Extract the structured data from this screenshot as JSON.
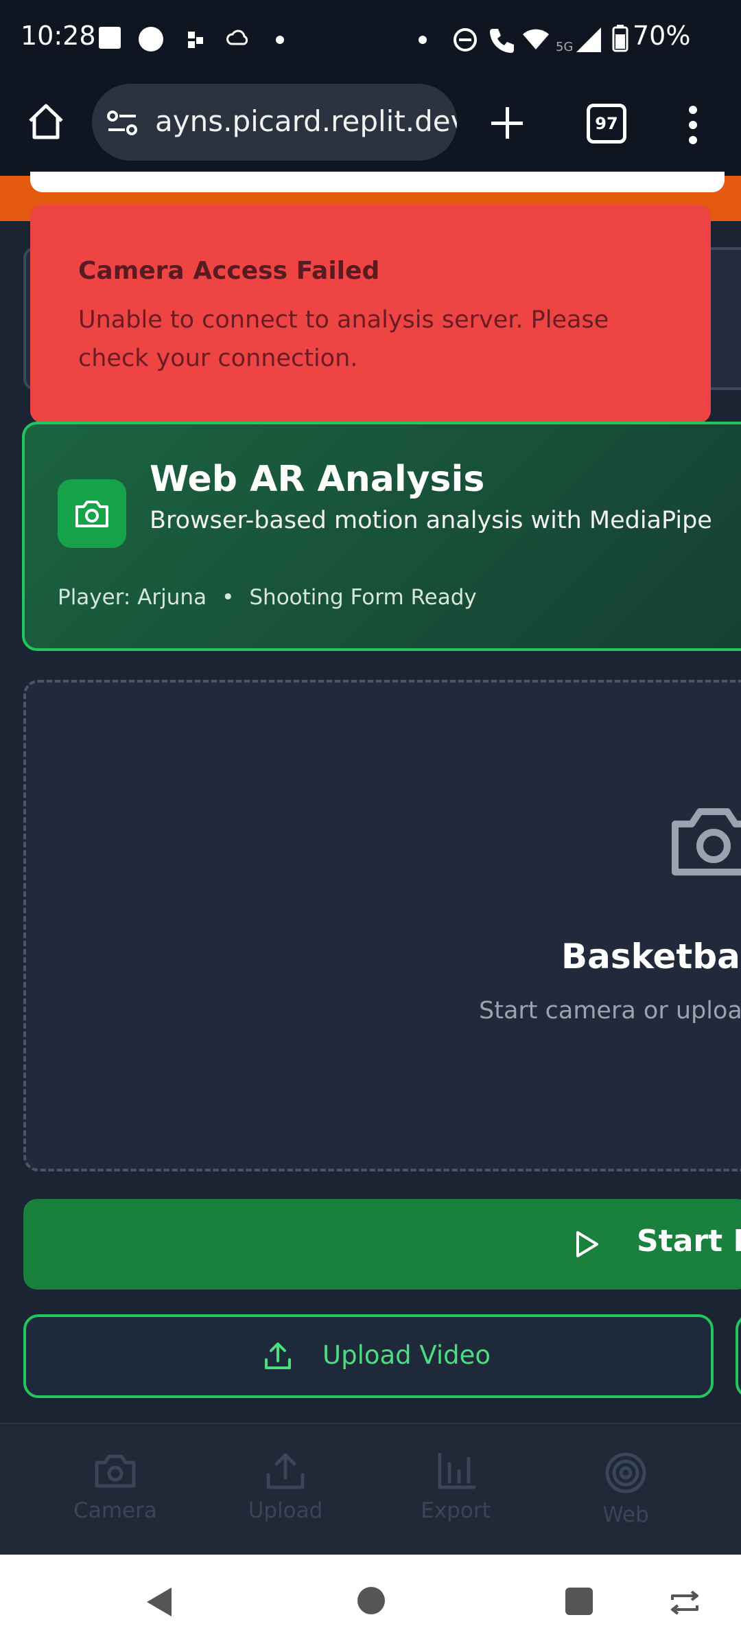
{
  "status_bar": {
    "time": "10:28",
    "network": "5G",
    "battery": "70%"
  },
  "browser": {
    "url": "ayns.picard.replit.dev",
    "tab_count": "97"
  },
  "toast": {
    "title": "Camera Access Failed",
    "message": "Unable to connect to analysis server. Please check your connection."
  },
  "ar_card": {
    "title": "Web AR Analysis",
    "subtitle": "Browser-based motion analysis with MediaPipe",
    "player": "Player: Arjuna",
    "status": "Shooting Form Ready"
  },
  "preview": {
    "title": "Basketball",
    "subtitle": "Start camera or upload"
  },
  "buttons": {
    "start_live": "Start Liv",
    "upload_video": "Upload Video"
  },
  "bottom_nav": [
    {
      "label": "Camera",
      "icon": "camera-icon"
    },
    {
      "label": "Upload",
      "icon": "upload-icon"
    },
    {
      "label": "Export",
      "icon": "bar-chart-icon"
    },
    {
      "label": "Web",
      "icon": "target-icon"
    }
  ],
  "colors": {
    "toast_bg": "#ef4444",
    "accent_green": "#22c55e",
    "page_bg": "#1b2433",
    "start_btn": "#19803d"
  }
}
